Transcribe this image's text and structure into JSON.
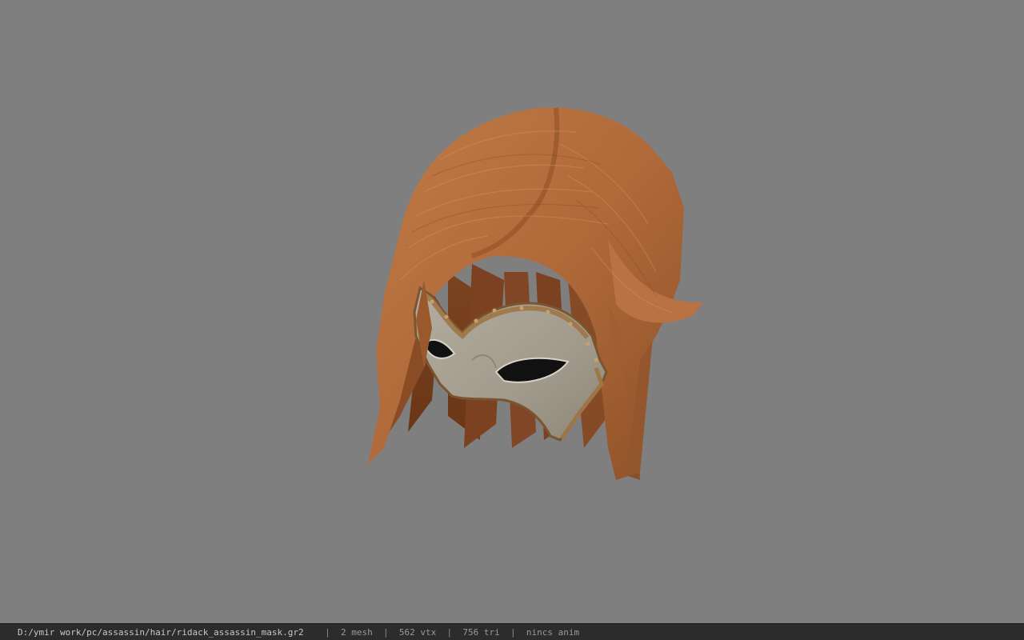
{
  "viewer": {
    "background_color": "#7f7f7f",
    "model_name": "ridack_assassin_mask"
  },
  "status": {
    "path": "D:/ymir work/pc/assassin/hair/ridack_assassin_mask.gr2",
    "separator": "|",
    "mesh": "2 mesh",
    "vtx": "562 vtx",
    "tri": "756 tri",
    "anim": "nincs anim"
  },
  "colors": {
    "hair": "#b06a3a",
    "mask": "#a9a295",
    "trim": "#8a5e33",
    "statusbar": "#2c2c2c"
  }
}
